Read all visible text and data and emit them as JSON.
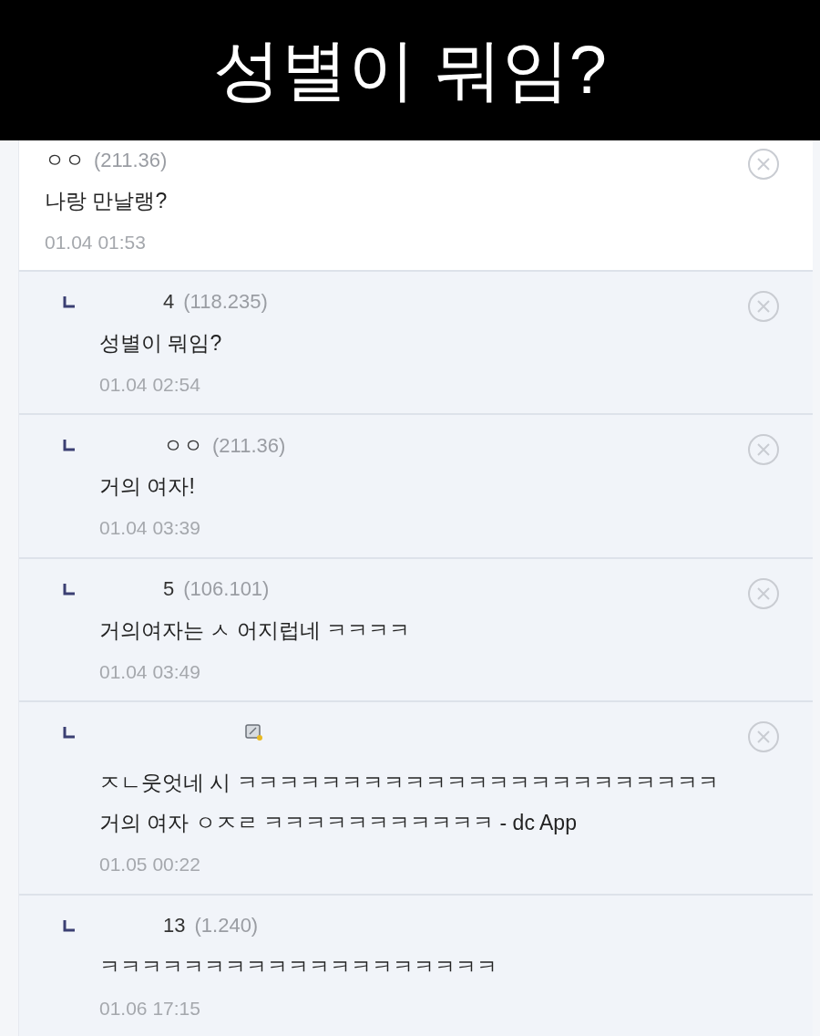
{
  "banner": {
    "title": "성별이 뭐임?"
  },
  "comments": [
    {
      "kind": "top",
      "nick": "ㅇㅇ",
      "ip": "(211.36)",
      "text": "나랑 만날랭?",
      "date": "01.04 01:53",
      "member_icon": false
    },
    {
      "kind": "reply",
      "nick": "4",
      "ip": "(118.235)",
      "text": "성별이 뭐임?",
      "date": "01.04 02:54",
      "member_icon": false
    },
    {
      "kind": "reply",
      "nick": "ㅇㅇ",
      "ip": "(211.36)",
      "text": "거의 여자!",
      "date": "01.04 03:39",
      "member_icon": false
    },
    {
      "kind": "reply",
      "nick": "5",
      "ip": "(106.101)",
      "text": "거의여자는 ㅅ    어지럽네 ㅋㅋㅋㅋ",
      "date": "01.04 03:49",
      "member_icon": false
    },
    {
      "kind": "reply",
      "text": "ㅈㄴ웃엇네 시   ㅋㅋㅋㅋㅋㅋㅋㅋㅋㅋㅋㅋㅋㅋㅋㅋㅋㅋㅋㅋㅋㅋㅋ 거의 여자 ㅇㅈㄹ ㅋㅋㅋㅋㅋㅋㅋㅋㅋㅋㅋ - dc App",
      "date": "01.05 00:22",
      "member_icon": true
    },
    {
      "kind": "reply",
      "nick": "13",
      "ip": "(1.240)",
      "text": "ㅋㅋㅋㅋㅋㅋㅋㅋㅋㅋㅋㅋㅋㅋㅋㅋㅋㅋㅋ",
      "date": "01.06 17:15",
      "member_icon": false
    }
  ]
}
